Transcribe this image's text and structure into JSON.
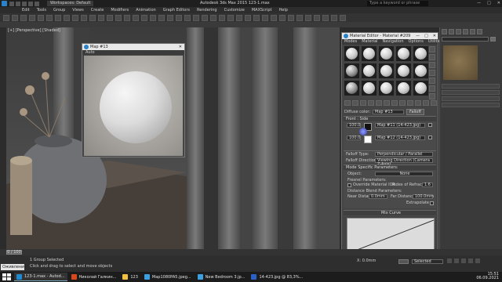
{
  "titlebar": {
    "workspace": "Workspaces: Default",
    "app_title": "Autodesk 3ds Max 2015    123-1.max",
    "search_placeholder": "Type a keyword or phrase"
  },
  "menubar": [
    "Edit",
    "Tools",
    "Group",
    "Views",
    "Create",
    "Modifiers",
    "Animation",
    "Graph Editors",
    "Rendering",
    "Customize",
    "MAXScript",
    "Help"
  ],
  "viewport": {
    "label": "[+] [Perspective] [Shaded]"
  },
  "map_window": {
    "title": "Map #13",
    "toolbar": "Auto"
  },
  "material_editor": {
    "title": "Material Editor - Material #209",
    "menus": [
      "Modes",
      "Material",
      "Navigation",
      "Options",
      "Utilities"
    ],
    "map_label": "Diffuse color:",
    "map_name": "Map #13",
    "map_type": "Falloff",
    "falloff_params_header": "Front : Side",
    "front_value": "100.0",
    "side_value": "100.0",
    "map1": "Map #11 (14-423.jpg)",
    "map2": "Map #12 (14-423.jpg)",
    "falloff_type_label": "Falloff Type:",
    "falloff_type": "Perpendicular / Parallel",
    "falloff_dir_label": "Falloff Direction:",
    "falloff_dir": "Viewing Direction (Camera Z-Axis)",
    "mode_specific": "Mode Specific Parameters:",
    "object_label": "Object:",
    "object_value": "None",
    "fresnel": "Fresnel Parameters:",
    "override_ior": "Override Material IOR",
    "index_label": "Index of Refraction",
    "index_value": "1.6",
    "distance_blend": "Distance Blend Parameters:",
    "near_label": "Near Distance:",
    "near_value": "0.0mm",
    "far_label": "Far Distance:",
    "far_value": "100.0mm",
    "extrapolate": "Extrapolate",
    "mix_curve": "Mix Curve"
  },
  "status": {
    "maxscript": "Оживление",
    "line1": "1 Group Selected",
    "line2": "Click and drag to select and move objects",
    "scrub": "0 / 100",
    "coords": "X: 0.0mm",
    "selected": "Selected",
    "auto_key": "Auto Key",
    "set_key": "Set Key"
  },
  "taskbar": {
    "items": [
      {
        "label": "123-1.max - Autod...",
        "color": "#1f8ad2",
        "active": true
      },
      {
        "label": "Николай Галкин...",
        "color": "#d9481a",
        "active": false
      },
      {
        "label": "123",
        "color": "#f0c040",
        "active": false
      },
      {
        "label": "Map1080PA5.jpeg...",
        "color": "#3ca0e0",
        "active": false
      },
      {
        "label": "New Bedroom 3.jp...",
        "color": "#3ca0e0",
        "active": false
      },
      {
        "label": "14-423.jpg @ 83,3%...",
        "color": "#2a60c8",
        "active": false
      }
    ],
    "time": "15:51",
    "date": "06.09.2021"
  }
}
